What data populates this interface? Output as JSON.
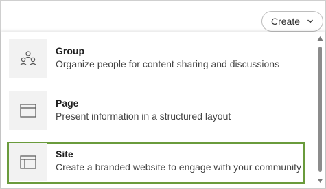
{
  "header": {
    "create_label": "Create"
  },
  "menu": {
    "items": [
      {
        "title": "Group",
        "description": "Organize people for content sharing and discussions",
        "icon": "group-icon",
        "selected": false
      },
      {
        "title": "Page",
        "description": "Present information in a structured layout",
        "icon": "page-layout-icon",
        "selected": false
      },
      {
        "title": "Site",
        "description": "Create a branded website to engage with your community",
        "icon": "site-layout-icon",
        "selected": true
      }
    ]
  },
  "colors": {
    "selection_border": "#6a9b3c",
    "tile_background": "#f2f2f2",
    "scroll_thumb": "#8c8c8c"
  }
}
